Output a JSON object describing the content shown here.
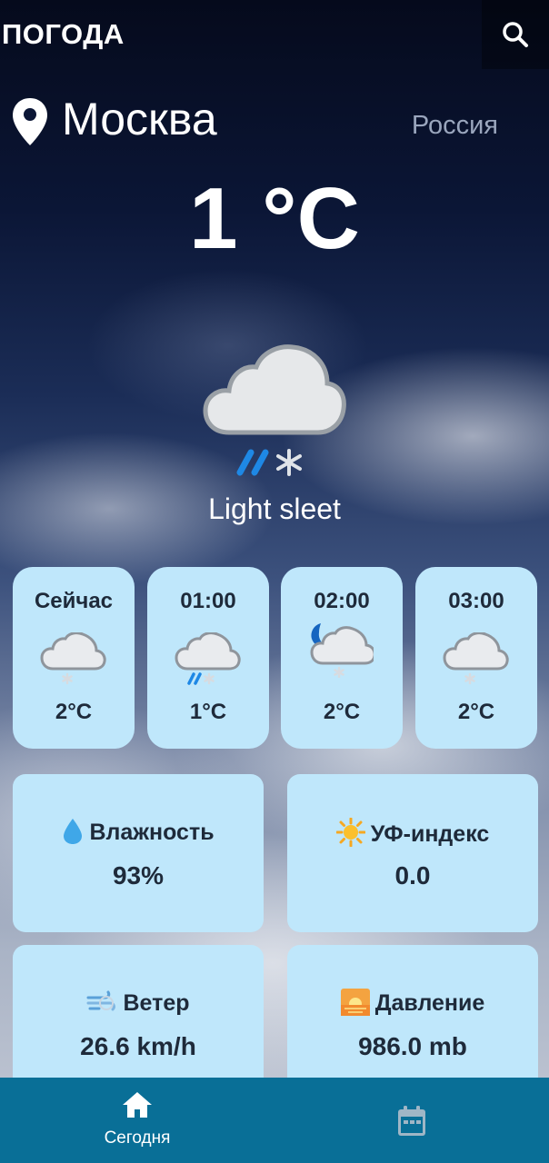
{
  "app": {
    "title": "ПОГОДА"
  },
  "header": {
    "search_icon": "search-icon"
  },
  "location": {
    "city": "Москва",
    "country": "Россия",
    "icon": "location-pin-icon"
  },
  "current": {
    "temperature": "1 °C",
    "condition": "Light sleet",
    "icon": "cloud-sleet-icon"
  },
  "hourly": [
    {
      "time": "Сейчас",
      "temp": "2°C",
      "icon": "cloud-snow-icon"
    },
    {
      "time": "01:00",
      "temp": "1°C",
      "icon": "cloud-sleet-icon"
    },
    {
      "time": "02:00",
      "temp": "2°C",
      "icon": "moon-cloud-snow-icon"
    },
    {
      "time": "03:00",
      "temp": "2°C",
      "icon": "cloud-snow-icon"
    }
  ],
  "details": {
    "humidity": {
      "label": "Влажность",
      "value": "93%",
      "icon": "droplet-icon"
    },
    "uv": {
      "label": "УФ-индекс",
      "value": "0.0",
      "icon": "sun-icon"
    },
    "wind": {
      "label": "Ветер",
      "value": "26.6 km/h",
      "icon": "wind-icon"
    },
    "pressure": {
      "label": "Давление",
      "value": "986.0 mb",
      "icon": "sunrise-icon"
    }
  },
  "nav": {
    "today_label": "Сегодня",
    "today_icon": "home-icon",
    "calendar_icon": "calendar-icon"
  },
  "colors": {
    "card_bg": "#bfe7fb",
    "nav_bg": "#096f97",
    "text_dark": "#1e2a3a",
    "accent_blue": "#1e88e5"
  }
}
